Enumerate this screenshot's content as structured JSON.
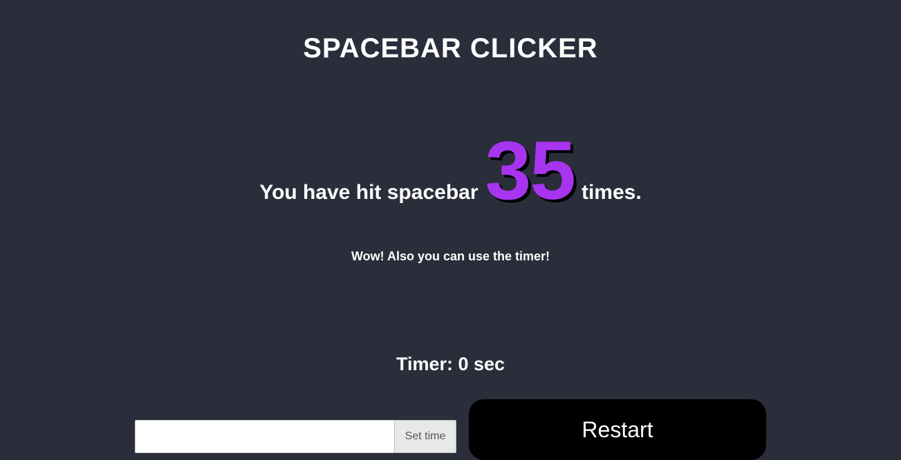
{
  "title": "SPACEBAR CLICKER",
  "counter": {
    "prefix": "You have hit spacebar ",
    "value": "35",
    "suffix": " times."
  },
  "hint": "Wow! Also you can use the timer!",
  "timer": {
    "label": "Timer: ",
    "value": "0",
    "unit": " sec"
  },
  "controls": {
    "time_input_value": "",
    "set_time_label": "Set time",
    "restart_label": "Restart"
  }
}
